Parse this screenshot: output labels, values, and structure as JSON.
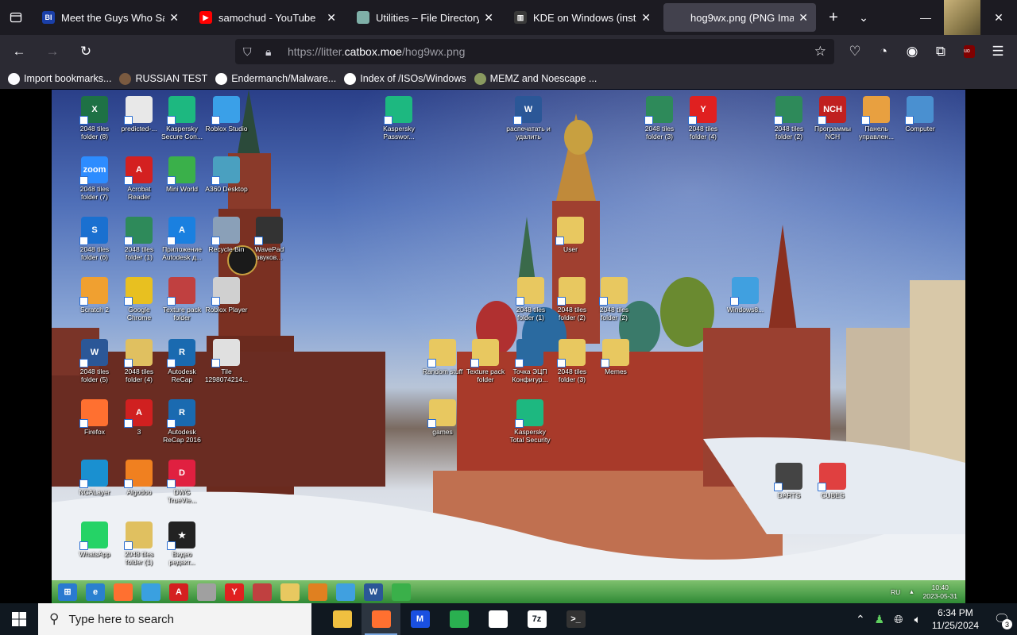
{
  "browser": {
    "tabs": [
      {
        "title": "Meet the Guys Who Sabot",
        "fav_text": "BI",
        "fav_color": "#1a3fa8",
        "active": false
      },
      {
        "title": "samochud - YouTube",
        "fav_text": "▶",
        "fav_color": "#ff0000",
        "active": false
      },
      {
        "title": "Utilities – File Directory",
        "fav_text": "",
        "fav_color": "#7fb0a8",
        "active": false
      },
      {
        "title": "KDE on Windows (installer",
        "fav_text": "▥",
        "fav_color": "#3a3a3a",
        "active": false
      },
      {
        "title": "hog9wx.png (PNG Image, 160",
        "fav_text": "",
        "fav_color": "#42414d",
        "active": true
      }
    ],
    "url_prefix": "https://litter.",
    "url_domain": "catbox.moe",
    "url_path": "/hog9wx.png",
    "bookmarks": [
      {
        "label": "Import bookmarks...",
        "color": "#fbfbfe"
      },
      {
        "label": "RUSSIAN TEST",
        "color": "#7a5a40"
      },
      {
        "label": "Endermanch/Malware...",
        "color": "#ffffff"
      },
      {
        "label": "Index of /ISOs/Windows",
        "color": "#ffffff"
      },
      {
        "label": "MEMZ and Noescape ...",
        "color": "#8a9a60"
      }
    ]
  },
  "desktop_icons": [
    {
      "label": "2048 tiles folder (8)",
      "color": "#1e7145",
      "text": "X"
    },
    {
      "label": "predicted-...",
      "color": "#e8e8e8",
      "text": ""
    },
    {
      "label": "Kaspersky Secure Con...",
      "color": "#1db880",
      "text": ""
    },
    {
      "label": "Roblox Studio",
      "color": "#3aa0e8",
      "text": ""
    },
    {
      "label": "Kaspersky Passwor...",
      "color": "#1db880",
      "text": ""
    },
    {
      "label": "распечатать и удалить",
      "color": "#2b5797",
      "text": "W"
    },
    {
      "label": "2048 tiles folder (3)",
      "color": "#2e8a5a",
      "text": ""
    },
    {
      "label": "2048 tiles folder (4)",
      "color": "#e02020",
      "text": "Y"
    },
    {
      "label": "2048 tiles folder (2)",
      "color": "#2e8a5a",
      "text": ""
    },
    {
      "label": "Программы NCH",
      "color": "#c02020",
      "text": "NCH"
    },
    {
      "label": "Панель управлен...",
      "color": "#e8a040",
      "text": ""
    },
    {
      "label": "Computer",
      "color": "#4a90d0",
      "text": ""
    },
    {
      "label": "2048 tiles folder (7)",
      "color": "#2d8cff",
      "text": "zoom"
    },
    {
      "label": "Acrobat Reader",
      "color": "#d42020",
      "text": "A"
    },
    {
      "label": "Mini World",
      "color": "#3ab04a",
      "text": ""
    },
    {
      "label": "A360 Desktop",
      "color": "#4aa0c0",
      "text": ""
    },
    {
      "label": "2048 tiles folder (6)",
      "color": "#1a70d0",
      "text": "S"
    },
    {
      "label": "2048 tiles folder (1)",
      "color": "#2e8a5a",
      "text": ""
    },
    {
      "label": "Приложение Autodesk д...",
      "color": "#1a80e0",
      "text": "A"
    },
    {
      "label": "Recycle Bin",
      "color": "#8aa0b8",
      "text": ""
    },
    {
      "label": "WavePad звуков...",
      "color": "#333333",
      "text": ""
    },
    {
      "label": "Scratch 2",
      "color": "#f0a030",
      "text": ""
    },
    {
      "label": "Google Chrome",
      "color": "#e8c020",
      "text": ""
    },
    {
      "label": "Texture pack folder",
      "color": "#c04040",
      "text": ""
    },
    {
      "label": "Roblox Player",
      "color": "#d0d0d0",
      "text": ""
    },
    {
      "label": "2048 tiles folder (5)",
      "color": "#2b5797",
      "text": "W"
    },
    {
      "label": "2048 tiles folder (4)",
      "color": "#e0c060",
      "text": ""
    },
    {
      "label": "Autodesk ReCap",
      "color": "#1a6ab0",
      "text": "R"
    },
    {
      "label": "Tile 1298074214...",
      "color": "#e0e0e0",
      "text": ""
    },
    {
      "label": "Firefox",
      "color": "#ff7030",
      "text": ""
    },
    {
      "label": "3",
      "color": "#d02020",
      "text": "A"
    },
    {
      "label": "Autodesk ReCap 2016",
      "color": "#1a6ab0",
      "text": "R"
    },
    {
      "label": "NCALayer",
      "color": "#1a90d0",
      "text": ""
    },
    {
      "label": "Algodoo",
      "color": "#f08020",
      "text": ""
    },
    {
      "label": "DWG TrueVie...",
      "color": "#e02040",
      "text": "D"
    },
    {
      "label": "WhatsApp",
      "color": "#25d366",
      "text": ""
    },
    {
      "label": "2048 tiles folder (1)",
      "color": "#e0c060",
      "text": ""
    },
    {
      "label": "Видео редакт...",
      "color": "#222222",
      "text": "★"
    },
    {
      "label": "User",
      "color": "#e8c860",
      "text": ""
    },
    {
      "label": "2048 tiles folder (1)",
      "color": "#e8c860",
      "text": ""
    },
    {
      "label": "2048 tiles folder (2)",
      "color": "#e8c860",
      "text": ""
    },
    {
      "label": "2048 tiles folder (2)",
      "color": "#e8c860",
      "text": ""
    },
    {
      "label": "Windows8...",
      "color": "#40a0e0",
      "text": ""
    },
    {
      "label": "Random stuff",
      "color": "#e8c860",
      "text": ""
    },
    {
      "label": "Texture pack folder",
      "color": "#e8c860",
      "text": ""
    },
    {
      "label": "Точка ЭЦП Конфигур...",
      "color": "#2a6aa0",
      "text": ""
    },
    {
      "label": "2048 tiles folder (3)",
      "color": "#e8c860",
      "text": ""
    },
    {
      "label": "Memes",
      "color": "#e8c860",
      "text": ""
    },
    {
      "label": "games",
      "color": "#e8c860",
      "text": ""
    },
    {
      "label": "Kaspersky Total Security",
      "color": "#1db880",
      "text": ""
    },
    {
      "label": "DARTS",
      "color": "#444444",
      "text": ""
    },
    {
      "label": "CUBES",
      "color": "#e04040",
      "text": ""
    }
  ],
  "mini_taskbar": {
    "apps": [
      {
        "color": "#2a7ad0",
        "text": "⊞"
      },
      {
        "color": "#2a80d0",
        "text": "e"
      },
      {
        "color": "#ff7030",
        "text": ""
      },
      {
        "color": "#3aa0e0",
        "text": ""
      },
      {
        "color": "#d42020",
        "text": "A"
      },
      {
        "color": "#a0a0a0",
        "text": ""
      },
      {
        "color": "#e02020",
        "text": "Y"
      },
      {
        "color": "#c04040",
        "text": ""
      },
      {
        "color": "#e8c860",
        "text": ""
      },
      {
        "color": "#e08020",
        "text": ""
      },
      {
        "color": "#40a0e0",
        "text": ""
      },
      {
        "color": "#2b5797",
        "text": "W"
      },
      {
        "color": "#3ab04a",
        "text": ""
      }
    ],
    "lang": "RU",
    "time": "10:40",
    "date": "2023-05-31"
  },
  "taskbar": {
    "search_placeholder": "Type here to search",
    "apps": [
      {
        "name": "file-explorer",
        "color": "#f0c040",
        "text": "",
        "active": false
      },
      {
        "name": "firefox",
        "color": "#ff7030",
        "text": "",
        "active": true
      },
      {
        "name": "malwarebytes",
        "color": "#1a50e0",
        "text": "M",
        "active": false
      },
      {
        "name": "contacts",
        "color": "#2ab050",
        "text": "",
        "active": false
      },
      {
        "name": "security",
        "color": "#ffffff",
        "text": "",
        "active": false
      },
      {
        "name": "7zip",
        "color": "#ffffff",
        "text": "7z",
        "active": false
      },
      {
        "name": "terminal",
        "color": "#333333",
        "text": ">_",
        "active": false
      }
    ],
    "time": "6:34 PM",
    "date": "11/25/2024",
    "notification_count": "3"
  }
}
